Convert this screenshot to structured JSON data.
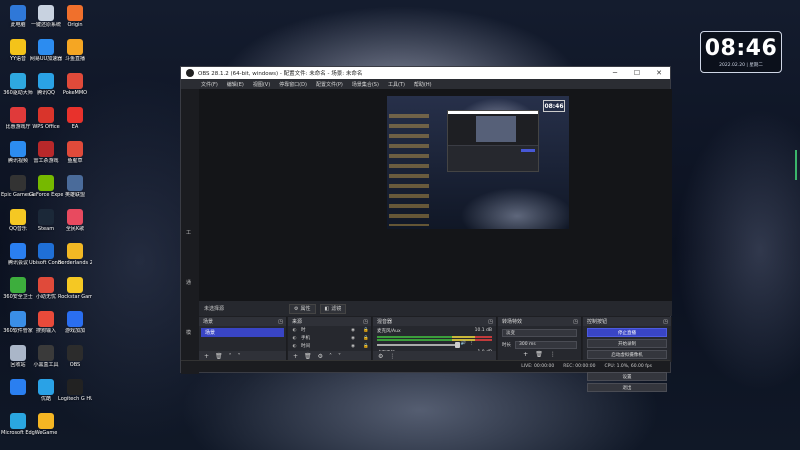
{
  "desktop": {
    "icons": [
      {
        "label": "此电脑",
        "color": "#2f78d8"
      },
      {
        "label": "一键还原系统",
        "color": "#c8d2e0"
      },
      {
        "label": "Origin",
        "color": "#f0702c"
      },
      {
        "label": "YY语音",
        "color": "#f4c31a"
      },
      {
        "label": "网易UU加速器",
        "color": "#2c8cf0"
      },
      {
        "label": "斗鱼直播",
        "color": "#f5a623"
      },
      {
        "label": "360驱动大师",
        "color": "#2ea8e0"
      },
      {
        "label": "腾讯QQ",
        "color": "#2aa2e6"
      },
      {
        "label": "PokeMMO",
        "color": "#e04a3a"
      },
      {
        "label": "比惠游戏厅",
        "color": "#e03a3a"
      },
      {
        "label": "WPS Office",
        "color": "#d9342b"
      },
      {
        "label": "EA",
        "color": "#e8322c"
      },
      {
        "label": "腾讯视频",
        "color": "#2c8cf0"
      },
      {
        "label": "雷工杀游戏",
        "color": "#b8282a"
      },
      {
        "label": "鱼腥草",
        "color": "#e04a3a"
      },
      {
        "label": "Epic Games Launcher",
        "color": "#333333"
      },
      {
        "label": "GeForce Experience",
        "color": "#76b900"
      },
      {
        "label": "英雄联盟",
        "color": "#4a6b9a"
      },
      {
        "label": "QQ音乐",
        "color": "#f5c823"
      },
      {
        "label": "Steam",
        "color": "#1b2838"
      },
      {
        "label": "全民K歌",
        "color": "#e84a5f"
      },
      {
        "label": "腾讯会议",
        "color": "#2a7ff0"
      },
      {
        "label": "Ubisoft Connect",
        "color": "#1f6fd6"
      },
      {
        "label": "Borderlands 2",
        "color": "#f2b824"
      },
      {
        "label": "360安全卫士",
        "color": "#3dae3d"
      },
      {
        "label": "小助无忧",
        "color": "#e04a3a"
      },
      {
        "label": "Rockstar Games",
        "color": "#f5c823"
      },
      {
        "label": "360软件管家",
        "color": "#3a8ee6"
      },
      {
        "label": "搜狗输入",
        "color": "#e84a3a"
      },
      {
        "label": "游戏加加",
        "color": "#2a6ef0"
      },
      {
        "label": "回收站",
        "color": "#aab6c8"
      },
      {
        "label": "小黑盒工具",
        "color": "#3a3a3a"
      },
      {
        "label": "OBS",
        "color": "#2c2c2c"
      },
      {
        "label": "",
        "color": "#2a7ff0"
      },
      {
        "label": "优酷",
        "color": "#2aa2e6"
      },
      {
        "label": "Logitech G HUB",
        "color": "#222222"
      },
      {
        "label": "Microsoft Edge",
        "color": "#2aa6e0"
      },
      {
        "label": "WeGame",
        "color": "#f5b623"
      }
    ],
    "clock": {
      "time": "08:46",
      "date": "2022.02.20 | 星期二"
    }
  },
  "obs": {
    "title": "OBS 28.1.2 (64-bit, windows) - 配置文件: 未命名 - 场景: 未命名",
    "window_buttons": [
      "─",
      "☐",
      "✕"
    ],
    "menu": [
      "文件(F)",
      "编辑(E)",
      "视图(V)",
      "停靠窗口(D)",
      "配置文件(P)",
      "场景集合(S)",
      "工具(T)",
      "帮助(H)"
    ],
    "preview_clock": "08:46",
    "left_strip": [
      "工",
      "通",
      "模"
    ],
    "context_bar": {
      "no_source": "未选择源",
      "properties": "属性",
      "filters": "滤镜"
    },
    "docks": {
      "scenes": {
        "title": "场景",
        "items": [
          "场景"
        ]
      },
      "sources": {
        "title": "来源",
        "items": [
          {
            "name": "时",
            "icon": "◐"
          },
          {
            "name": "手机",
            "icon": "◐"
          },
          {
            "name": "时间",
            "icon": "◐"
          },
          {
            "name": "弹幕",
            "icon": "◐"
          },
          {
            "name": "文本 (GDI+)",
            "icon": "T"
          },
          {
            "name": "视频采集设备",
            "icon": "▣"
          }
        ]
      },
      "mixer": {
        "title": "混音器",
        "channels": [
          {
            "name": "麦克风/Aux",
            "db": "10.1 dB"
          },
          {
            "name": "桌面音频",
            "db": "1.0 dB"
          }
        ]
      },
      "transitions": {
        "title": "转场特效",
        "selected": "淡变",
        "duration_label": "时长",
        "duration_value": "300 ms"
      },
      "controls": {
        "title": "控制按钮",
        "buttons": [
          "停止直播",
          "开始录制",
          "启动虚拟摄像机",
          "工作室模式",
          "设置",
          "退出"
        ]
      }
    },
    "status": {
      "live": "LIVE: 00:00:00",
      "rec": "REC: 00:00:00",
      "cpu": "CPU: 1.0%, 60.00 fps"
    }
  }
}
